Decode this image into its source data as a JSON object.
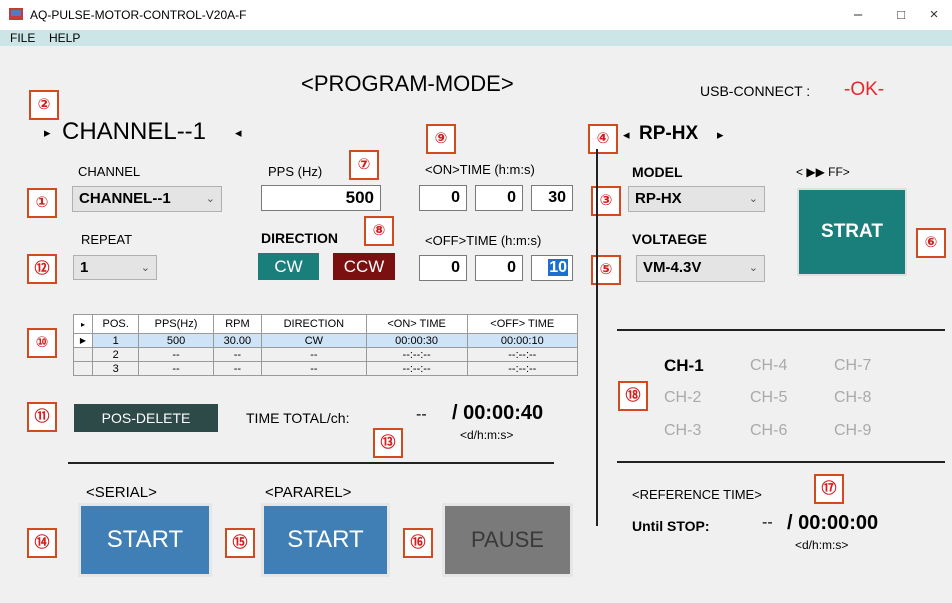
{
  "window": {
    "title": "AQ-PULSE-MOTOR-CONTROL-V20A-F",
    "min": "–",
    "max": "□",
    "close": "×"
  },
  "menu": [
    "FILE",
    "HELP"
  ],
  "mode_title": "<PROGRAM-MODE>",
  "usb": {
    "label": "USB-CONNECT :",
    "status": "-OK-",
    "status_color": "#e8262c"
  },
  "channel_header": {
    "left_arrow": "▸",
    "text": "CHANNEL--1",
    "right_arrow": "◂"
  },
  "model_header": {
    "left_arrow": "◂",
    "text": "RP-HX",
    "right_arrow": "▸"
  },
  "callouts": [
    "①",
    "②",
    "③",
    "④",
    "⑤",
    "⑥",
    "⑦",
    "⑧",
    "⑨",
    "⑩",
    "⑪",
    "⑫",
    "⑬",
    "⑭",
    "⑮",
    "⑯",
    "⑰",
    "⑱"
  ],
  "channel": {
    "label": "CHANNEL",
    "value": "CHANNEL--1"
  },
  "pps": {
    "label": "PPS (Hz)",
    "value": "500"
  },
  "on_time": {
    "label": "<ON>TIME (h:m:s)",
    "h": "0",
    "m": "0",
    "s": "30"
  },
  "off_time": {
    "label": "<OFF>TIME (h:m:s)",
    "h": "0",
    "m": "0",
    "s": "10"
  },
  "model": {
    "label": "MODEL",
    "value": "RP-HX"
  },
  "voltage": {
    "label": "VOLTAEGE",
    "value": "VM-4.3V"
  },
  "ff_label": "< ▶▶ FF>",
  "strat_button": "STRAT",
  "repeat": {
    "label": "REPEAT",
    "value": "1"
  },
  "direction": {
    "label": "DIRECTION",
    "cw": "CW",
    "ccw": "CCW"
  },
  "table": {
    "headers": [
      "▸",
      "POS.",
      "PPS(Hz)",
      "RPM",
      "DIRECTION",
      "<ON> TIME",
      "<OFF> TIME"
    ],
    "rows": [
      [
        "▶",
        "1",
        "500",
        "30.00",
        "CW",
        "00:00:30",
        "00:00:10"
      ],
      [
        "",
        "2",
        "--",
        "--",
        "--",
        "--:--:--",
        "--:--:--"
      ],
      [
        "",
        "3",
        "--",
        "--",
        "--",
        "--:--:--",
        "--:--:--"
      ]
    ]
  },
  "pos_delete": "POS-DELETE",
  "time_total": {
    "label": "TIME TOTAL/ch:",
    "value": "--",
    "total": "/ 00:00:40",
    "format": "<d/h:m:s>"
  },
  "serial": {
    "label": "<SERIAL>",
    "button": "START"
  },
  "pararel": {
    "label": "<PARAREL>",
    "button": "START"
  },
  "pause": "PAUSE",
  "channels": {
    "active": "CH-1",
    "others": [
      "CH-4",
      "CH-7",
      "CH-2",
      "CH-5",
      "CH-8",
      "CH-3",
      "CH-6",
      "CH-9"
    ]
  },
  "reference": {
    "label": "<REFERENCE TIME>",
    "until": "Until STOP:",
    "value": "--",
    "total": "/ 00:00:00",
    "format": "<d/h:m:s>"
  },
  "colors": {
    "teal": "#1a7f7a",
    "dark_red": "#7a1010",
    "blue": "#3f7fb5",
    "gray": "#7a7a7a",
    "dark_teal": "#2e4a48"
  }
}
